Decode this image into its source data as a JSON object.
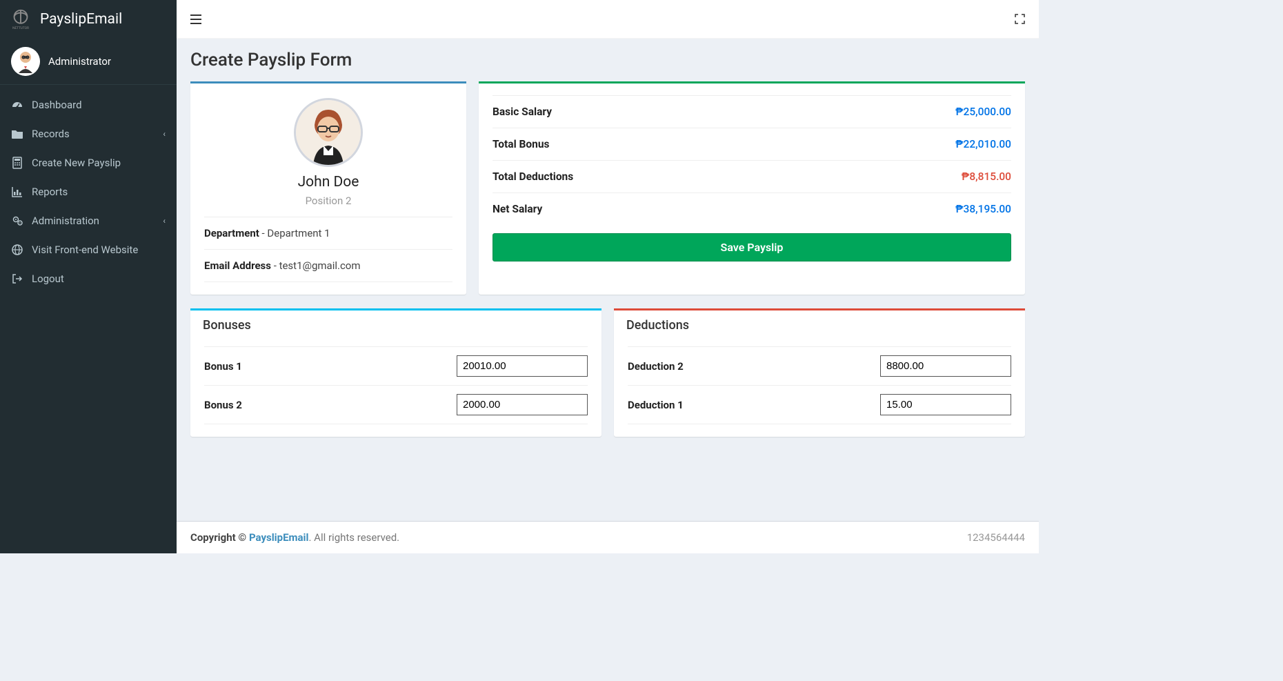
{
  "brand": {
    "name": "PayslipEmail"
  },
  "user": {
    "name": "Administrator"
  },
  "nav": [
    {
      "label": "Dashboard",
      "icon": "dashboard",
      "hasChevron": false
    },
    {
      "label": "Records",
      "icon": "folder",
      "hasChevron": true
    },
    {
      "label": "Create New Payslip",
      "icon": "calculator",
      "hasChevron": false
    },
    {
      "label": "Reports",
      "icon": "chart",
      "hasChevron": false
    },
    {
      "label": "Administration",
      "icon": "gears",
      "hasChevron": true
    },
    {
      "label": "Visit Front-end Website",
      "icon": "globe",
      "hasChevron": false
    },
    {
      "label": "Logout",
      "icon": "signout",
      "hasChevron": false
    }
  ],
  "page": {
    "title": "Create Payslip Form"
  },
  "profile": {
    "name": "John Doe",
    "position": "Position 2",
    "department_label": "Department",
    "department": "Department 1",
    "email_label": "Email Address",
    "email": "test1@gmail.com"
  },
  "summary": {
    "rows": [
      {
        "label": "Basic Salary",
        "value": "₱25,000.00",
        "cls": "blue"
      },
      {
        "label": "Total Bonus",
        "value": "₱22,010.00",
        "cls": "blue"
      },
      {
        "label": "Total Deductions",
        "value": "₱8,815.00",
        "cls": "red"
      },
      {
        "label": "Net Salary",
        "value": "₱38,195.00",
        "cls": "blue"
      }
    ],
    "save_label": "Save Payslip"
  },
  "bonuses": {
    "title": "Bonuses",
    "rows": [
      {
        "label": "Bonus 1",
        "value": "20010.00"
      },
      {
        "label": "Bonus 2",
        "value": "2000.00"
      }
    ]
  },
  "deductions": {
    "title": "Deductions",
    "rows": [
      {
        "label": "Deduction 2",
        "value": "8800.00"
      },
      {
        "label": "Deduction 1",
        "value": "15.00"
      }
    ]
  },
  "footer": {
    "copyright_prefix": "Copyright © ",
    "link_text": "PayslipEmail",
    "suffix": ". All rights reserved.",
    "right": "1234564444"
  }
}
